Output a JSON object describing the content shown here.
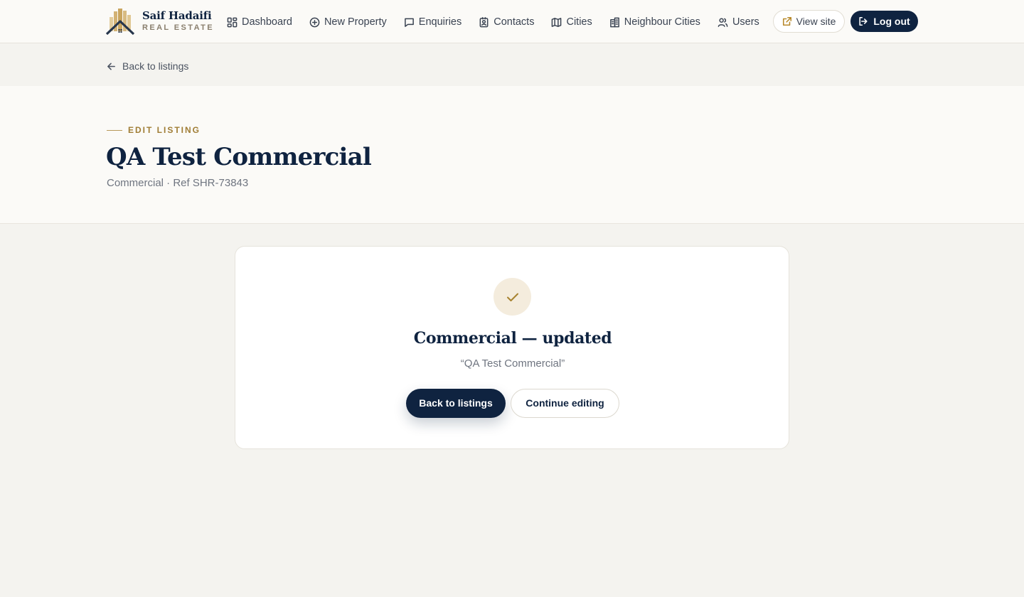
{
  "brand": {
    "name": "Saif Hadaifi",
    "tagline": "REAL ESTATE",
    "logo_icon": "building-logo-icon"
  },
  "nav": {
    "items": [
      {
        "label": "Dashboard",
        "icon": "dashboard-icon"
      },
      {
        "label": "New Property",
        "icon": "plus-circle-icon"
      },
      {
        "label": "Enquiries",
        "icon": "message-icon"
      },
      {
        "label": "Contacts",
        "icon": "contact-card-icon"
      },
      {
        "label": "Cities",
        "icon": "map-icon"
      },
      {
        "label": "Neighbour Cities",
        "icon": "buildings-icon"
      },
      {
        "label": "Users",
        "icon": "users-icon"
      }
    ],
    "view_site": "View site",
    "logout": "Log out"
  },
  "breadcrumb": {
    "back_label": "Back to listings"
  },
  "header": {
    "eyebrow": "EDIT LISTING",
    "title": "QA Test Commercial",
    "meta": "Commercial · Ref SHR-73843"
  },
  "success": {
    "title": "Commercial — updated",
    "subtitle": "“QA Test Commercial”",
    "primary_button": "Back to listings",
    "secondary_button": "Continue editing"
  },
  "colors": {
    "navy": "#0f2340",
    "gold": "#a7822f",
    "page_bg": "#f4f3ef",
    "card_bg": "#ffffff"
  }
}
